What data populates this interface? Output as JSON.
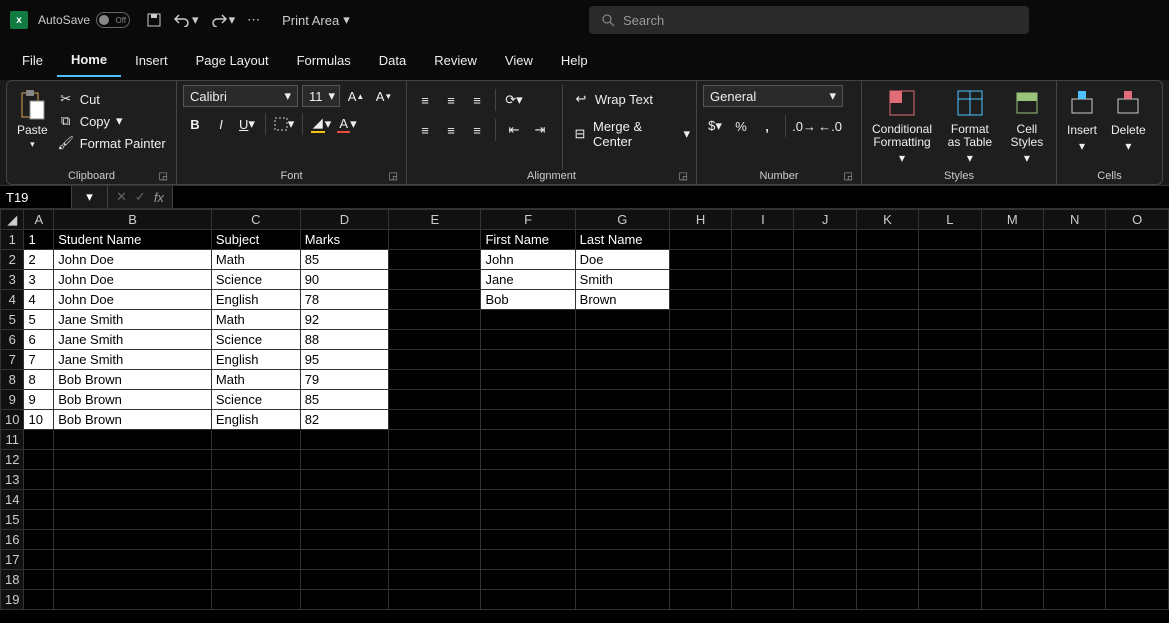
{
  "titlebar": {
    "autosave_label": "AutoSave",
    "autosave_state": "Off",
    "printarea_label": "Print Area",
    "search_placeholder": "Search"
  },
  "menu": {
    "file": "File",
    "home": "Home",
    "insert": "Insert",
    "page_layout": "Page Layout",
    "formulas": "Formulas",
    "data": "Data",
    "review": "Review",
    "view": "View",
    "help": "Help"
  },
  "ribbon": {
    "clipboard": {
      "label": "Clipboard",
      "paste": "Paste",
      "cut": "Cut",
      "copy": "Copy",
      "format_painter": "Format Painter"
    },
    "font": {
      "label": "Font",
      "name": "Calibri",
      "size": "11"
    },
    "alignment": {
      "label": "Alignment",
      "wrap": "Wrap Text",
      "merge": "Merge & Center"
    },
    "number": {
      "label": "Number",
      "format": "General"
    },
    "styles": {
      "label": "Styles",
      "cond": "Conditional Formatting",
      "table": "Format as Table",
      "cell": "Cell Styles"
    },
    "cells": {
      "label": "Cells",
      "insert": "Insert",
      "delete": "Delete"
    }
  },
  "formula_bar": {
    "cell_ref": "T19",
    "fx": "fx"
  },
  "columns": [
    "A",
    "B",
    "C",
    "D",
    "E",
    "F",
    "G",
    "H",
    "I",
    "J",
    "K",
    "L",
    "M",
    "N",
    "O"
  ],
  "sheet": {
    "header1": {
      "A": "1",
      "B": "Student Name",
      "C": "Subject",
      "D": "Marks",
      "F": "First Name",
      "G": "Last Name"
    },
    "rows": [
      {
        "A": "2",
        "B": "John Doe",
        "C": "Math",
        "D": "85",
        "F": "John",
        "G": "Doe"
      },
      {
        "A": "3",
        "B": "John Doe",
        "C": "Science",
        "D": "90",
        "F": "Jane",
        "G": "Smith"
      },
      {
        "A": "4",
        "B": "John Doe",
        "C": "English",
        "D": "78",
        "F": "Bob",
        "G": "Brown"
      },
      {
        "A": "5",
        "B": "Jane Smith",
        "C": "Math",
        "D": "92"
      },
      {
        "A": "6",
        "B": "Jane Smith",
        "C": "Science",
        "D": "88"
      },
      {
        "A": "7",
        "B": "Jane Smith",
        "C": "English",
        "D": "95"
      },
      {
        "A": "8",
        "B": "Bob Brown",
        "C": "Math",
        "D": "79"
      },
      {
        "A": "9",
        "B": "Bob Brown",
        "C": "Science",
        "D": "85"
      },
      {
        "A": "10",
        "B": "Bob Brown",
        "C": "English",
        "D": "82"
      }
    ]
  }
}
